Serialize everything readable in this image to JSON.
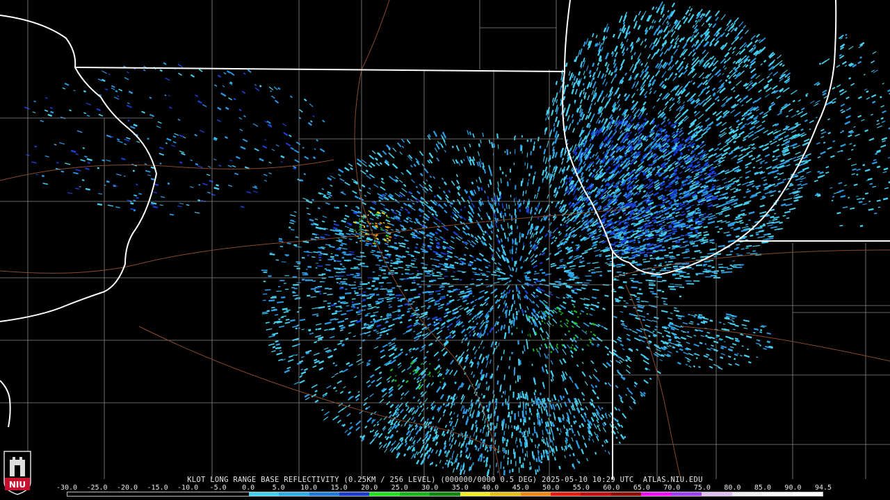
{
  "product": {
    "caption": "KLOT LONG RANGE BASE REFLECTIVITY (0.25KM / 256 LEVEL) (000000/0000 0.5 DEG) 2025-05-10 10:29 UTC  ATLAS.NIU.EDU",
    "radar_site": "KLOT",
    "timestamp": "2025-05-10 10:29 UTC",
    "source": "ATLAS.NIU.EDU"
  },
  "logo": {
    "text": "NIU",
    "color": "#c8102e",
    "icon": "niu-castle-logo"
  },
  "legend": {
    "unit_labels": [
      "-30.0",
      "-25.0",
      "-20.0",
      "-15.0",
      "-10.0",
      "-5.0",
      "0.0",
      "5.0",
      "10.0",
      "15.0",
      "20.0",
      "25.0",
      "30.0",
      "35.0",
      "40.0",
      "45.0",
      "50.0",
      "55.0",
      "60.0",
      "65.0",
      "70.0",
      "75.0",
      "80.0",
      "85.0",
      "90.0",
      "94.5"
    ],
    "colors": [
      "#000000",
      "#000000",
      "#000000",
      "#000000",
      "#000000",
      "#000000",
      "#41d3f0",
      "#2bb0e8",
      "#1e7bdc",
      "#1c3ed0",
      "#1fe41f",
      "#16b716",
      "#0f8a0f",
      "#f0f020",
      "#e8c018",
      "#f08a10",
      "#e82010",
      "#c01010",
      "#901008",
      "#f010f0",
      "#a040f0",
      "#e0c0f0",
      "#f0f0f0",
      "#f8f8f8",
      "#ffffff"
    ]
  },
  "map": {
    "background": "#000000",
    "state_border_color": "#ffffff",
    "county_border_color": "#8a8a8a",
    "road_color": "#8a4a2a",
    "echo_colors": {
      "light": "#46cfee",
      "medium": "#2a9ae4",
      "strong": "#1a3fd6",
      "green": "#1fbf1f",
      "yellow": "#e8d818",
      "orange": "#e88818"
    }
  }
}
